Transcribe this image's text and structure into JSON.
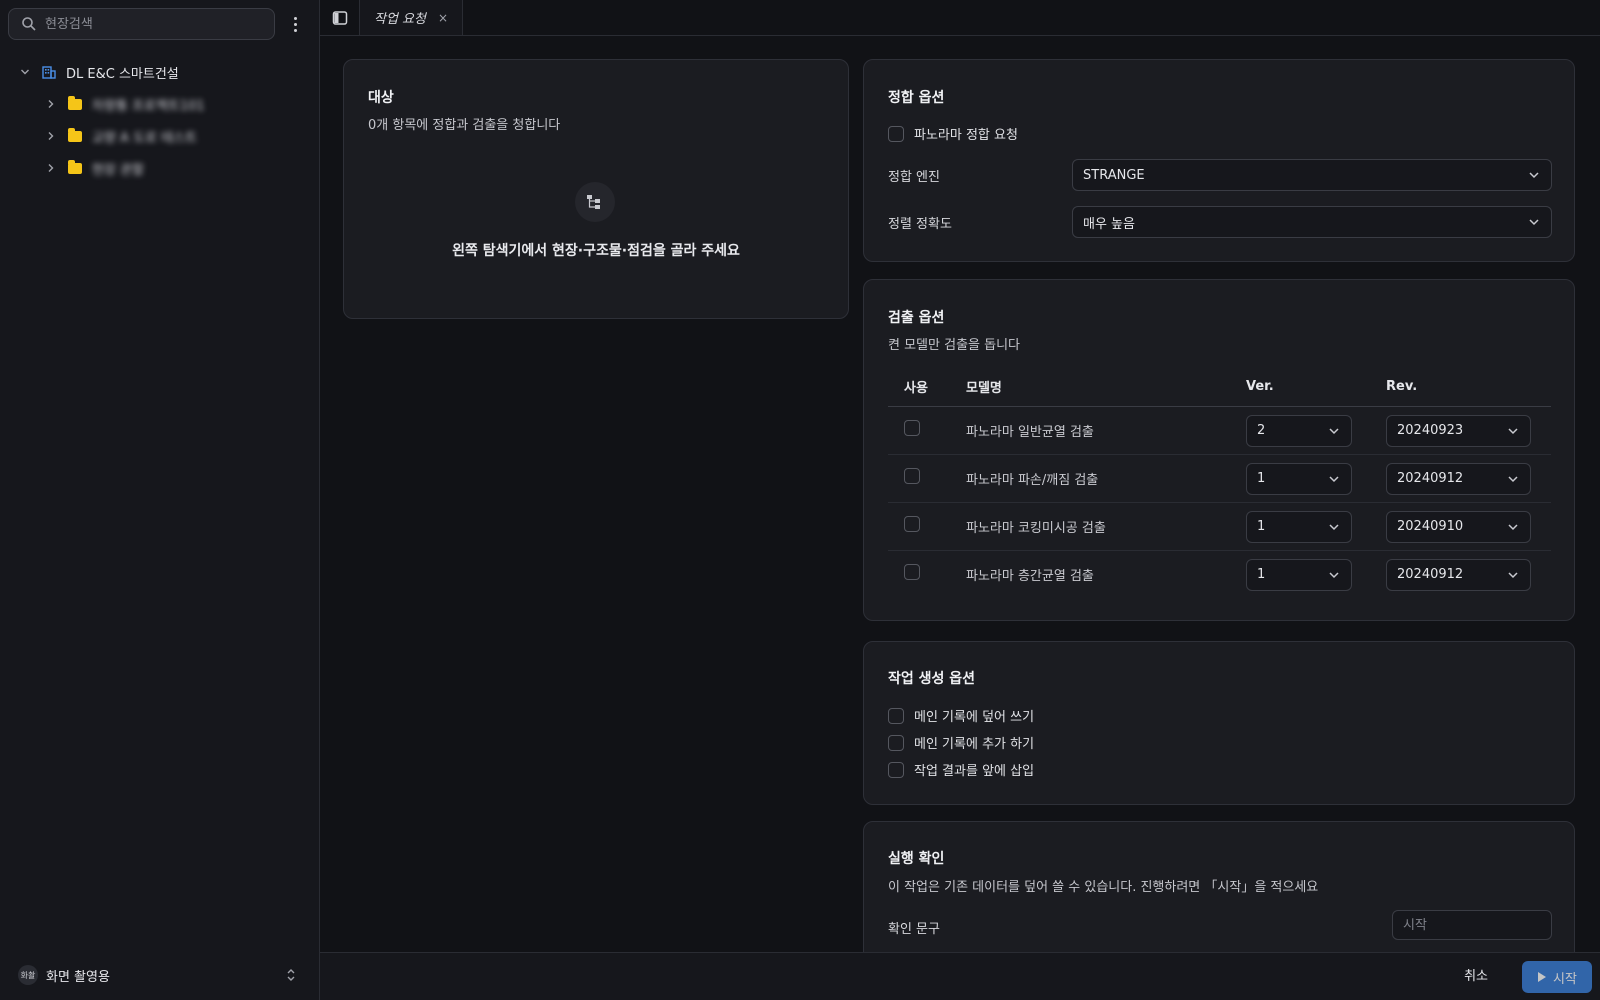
{
  "sidebar": {
    "search_placeholder": "현장검색",
    "tree": {
      "root_label": "DL E&C 스마트건설",
      "children": [
        {
          "label": "차량통 프로젝트101"
        },
        {
          "label": "교량 A 도로 테스트"
        },
        {
          "label": "현장 관할"
        }
      ]
    },
    "workspace": {
      "badge": "화촬",
      "name": "화면 촬영용"
    }
  },
  "tabs": [
    {
      "label": "작업 요청",
      "close": "×"
    }
  ],
  "target": {
    "title": "대상",
    "subtitle": "0개 항목에 정합과 검출을 청합니다",
    "empty_message": "왼쪽 탐색기에서 현장·구조물·점검을 골라 주세요"
  },
  "alignment": {
    "title": "정합 옵션",
    "panorama_checkbox": "파노라마 정합 요청",
    "engine_label": "정합 엔진",
    "engine_value": "STRANGE",
    "precision_label": "정렬 정확도",
    "precision_value": "매우 높음"
  },
  "detection": {
    "title": "검출 옵션",
    "subtitle": "켠 모델만 검출을 돕니다",
    "headers": {
      "use": "사용",
      "model": "모델명",
      "ver": "Ver.",
      "rev": "Rev."
    },
    "models": [
      {
        "name": "파노라마 일반균열 검출",
        "ver": "2",
        "rev": "20240923"
      },
      {
        "name": "파노라마 파손/깨짐 검출",
        "ver": "1",
        "rev": "20240912"
      },
      {
        "name": "파노라마 코킹미시공 검출",
        "ver": "1",
        "rev": "20240910"
      },
      {
        "name": "파노라마 층간균열 검출",
        "ver": "1",
        "rev": "20240912"
      }
    ]
  },
  "job": {
    "title": "작업 생성 옵션",
    "options": [
      "메인 기록에 덮어 쓰기",
      "메인 기록에 추가 하기",
      "작업 결과를 앞에 삽입"
    ]
  },
  "confirm": {
    "title": "실행 확인",
    "subtitle": "이 작업은 기존 데이터를 덮어 쓸 수 있습니다. 진행하려면 「시작」을 적으세요",
    "field_label": "확인 문구",
    "placeholder": "시작"
  },
  "footer": {
    "cancel": "취소",
    "start": "시작"
  },
  "colors": {
    "accent": "#3b7fd9",
    "folder": "#f5c518",
    "building": "#4a8fe7"
  }
}
